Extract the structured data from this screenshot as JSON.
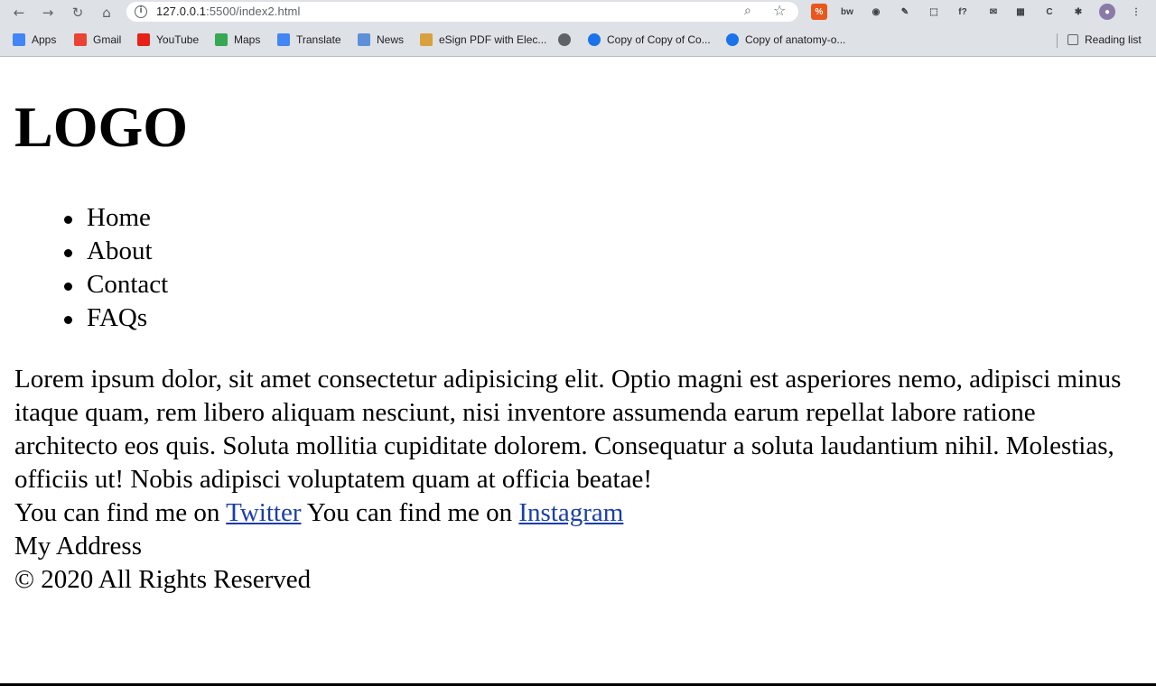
{
  "browser": {
    "url_host": "127.0.0.1",
    "url_rest": ":5500/index2.html",
    "extensions": [
      {
        "name": "ext-orange-icon",
        "color": "#e8581c",
        "glyph": "%"
      },
      {
        "name": "ext-bw-icon",
        "color": "#dee1e6",
        "glyph": "bw"
      },
      {
        "name": "ext-target-icon",
        "color": "#dee1e6",
        "glyph": "◉"
      },
      {
        "name": "ext-eyedropper-icon",
        "color": "#dee1e6",
        "glyph": "✎"
      },
      {
        "name": "ext-dashed-icon",
        "color": "#dee1e6",
        "glyph": "⬚"
      },
      {
        "name": "ext-function-icon",
        "color": "#dee1e6",
        "glyph": "f?"
      },
      {
        "name": "ext-translate-icon",
        "color": "#dee1e6",
        "glyph": "✉"
      },
      {
        "name": "ext-squares-icon",
        "color": "#dee1e6",
        "glyph": "▦"
      },
      {
        "name": "ext-c-icon",
        "color": "#dee1e6",
        "glyph": "C"
      },
      {
        "name": "ext-puzzle-icon",
        "color": "#dee1e6",
        "glyph": "✱"
      },
      {
        "name": "profile-avatar",
        "color": "#8a7aa8",
        "glyph": "●"
      },
      {
        "name": "menu-dots-icon",
        "color": "#dee1e6",
        "glyph": "⋮"
      }
    ],
    "bookmarks": [
      {
        "label": "Apps",
        "color": "#4285f4"
      },
      {
        "label": "Gmail",
        "color": "#ea4335"
      },
      {
        "label": "YouTube",
        "color": "#e62117"
      },
      {
        "label": "Maps",
        "color": "#34a853"
      },
      {
        "label": "Translate",
        "color": "#4285f4"
      },
      {
        "label": "News",
        "color": "#5f8fd8"
      },
      {
        "label": "eSign PDF with Elec...",
        "color": "#d7a13c"
      },
      {
        "label": "",
        "color": "#5f6368"
      },
      {
        "label": "Copy of Copy of Co...",
        "color": "#1a73e8"
      },
      {
        "label": "Copy of anatomy-o...",
        "color": "#1a73e8"
      }
    ],
    "reading_list": "Reading list"
  },
  "page": {
    "logo": "LOGO",
    "nav": [
      "Home",
      "About",
      "Contact",
      "FAQs"
    ],
    "paragraph": "Lorem ipsum dolor, sit amet consectetur adipisicing elit. Optio magni est asperiores nemo, adipisci minus itaque quam, rem libero aliquam nesciunt, nisi inventore assumenda earum repellat labore ratione architecto eos quis. Soluta mollitia cupiditate dolorem. Consequatur a soluta laudantium nihil. Molestias, officiis ut! Nobis adipisci voluptatem quam at officia beatae!",
    "find_text": "You can find me on",
    "twitter": "Twitter",
    "instagram": "Instagram",
    "address": "My Address",
    "copyright": "© 2020 All Rights Reserved"
  }
}
